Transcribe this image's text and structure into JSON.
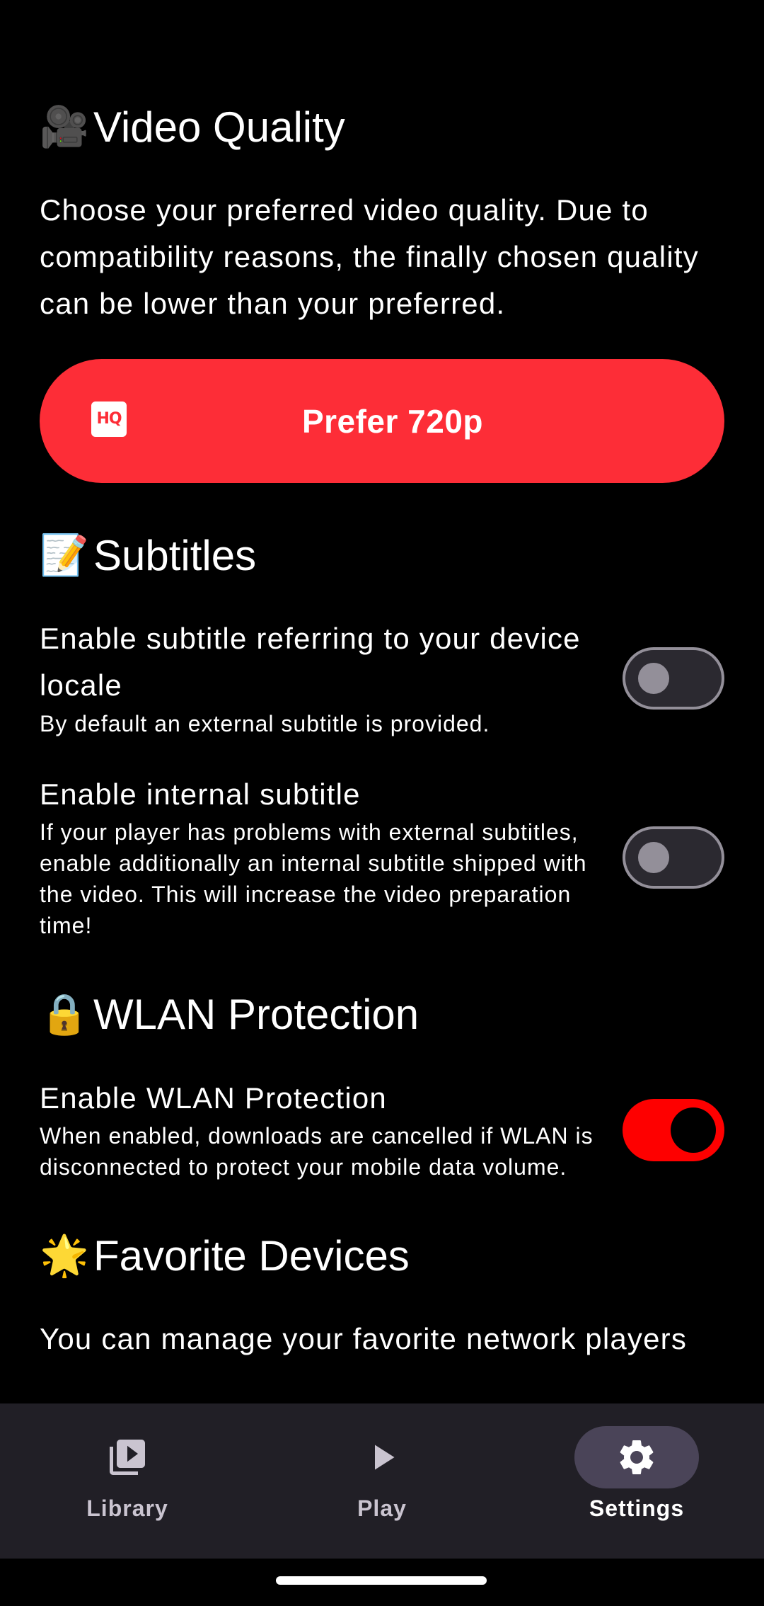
{
  "video_quality": {
    "emoji": "🎥",
    "title": "Video Quality",
    "description": "Choose your preferred video quality. Due to compatibility reasons, the finally chosen quality can be lower than your preferred.",
    "button_icon": "HQ",
    "button_label": "Prefer 720p"
  },
  "subtitles": {
    "emoji": "📝",
    "title": "Subtitles",
    "locale_setting": {
      "title": "Enable subtitle referring to your device locale",
      "subtitle": "By default an external subtitle is provided.",
      "enabled": false
    },
    "internal_setting": {
      "title": "Enable internal subtitle",
      "subtitle": "If your player has problems with external subtitles, enable additionally an internal subtitle shipped with the video. This will increase the video preparation time!",
      "enabled": false
    }
  },
  "wlan": {
    "emoji": "🔒",
    "title": "WLAN Protection",
    "setting": {
      "title": "Enable WLAN Protection",
      "subtitle": "When enabled, downloads are cancelled if WLAN is disconnected to protect your mobile data volume.",
      "enabled": true
    }
  },
  "favorites": {
    "emoji": "🌟",
    "title": "Favorite Devices",
    "description": "You can manage your favorite network players"
  },
  "bottom_nav": {
    "items": [
      {
        "label": "Library",
        "icon": "video-library-icon",
        "active": false
      },
      {
        "label": "Play",
        "icon": "play-icon",
        "active": false
      },
      {
        "label": "Settings",
        "icon": "gear-icon",
        "active": true
      }
    ]
  },
  "colors": {
    "background": "#000000",
    "accent": "#fd2d37",
    "toggle_on": "#fe0000",
    "nav_background": "#211f26",
    "nav_indicator": "#4a4458"
  }
}
